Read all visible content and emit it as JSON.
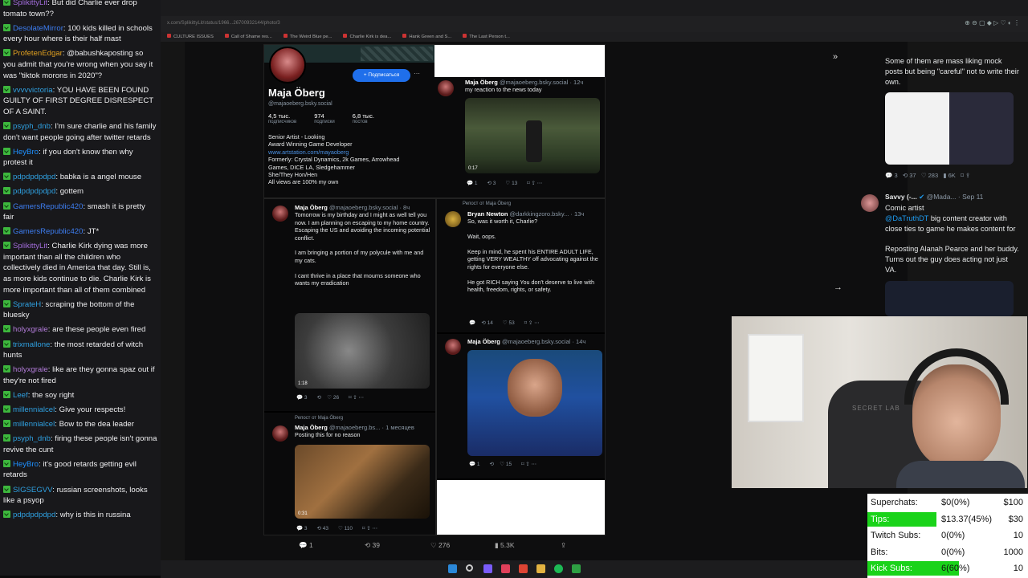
{
  "chat": [
    {
      "user": "SplikittyLit",
      "text": "But did Charlie ever drop tomato town??"
    },
    {
      "user": "DesolateMirror",
      "text": "100 kids killed in schools every hour where is their half mast"
    },
    {
      "user": "ProfetenEdgar",
      "text": "@babushkaposting so you admit that you're wrong when you say it was \"tiktok morons in 2020\"?"
    },
    {
      "user": "vvvvvictoria",
      "text": "YOU HAVE BEEN FOUND GUILTY OF FIRST DEGREE DISRESPECT OF A SAINT."
    },
    {
      "user": "psyph_dnb",
      "text": "I'm sure charlie and his family don't want people going after twitter retards"
    },
    {
      "user": "HeyBro",
      "text": "if you don't know then why protest it"
    },
    {
      "user": "pdpdpdpdpd",
      "text": "babka is a angel mouse"
    },
    {
      "user": "pdpdpdpdpd",
      "text": "gottem"
    },
    {
      "user": "GamersRepublic420",
      "text": "smash it is pretty fair"
    },
    {
      "user": "GamersRepublic420",
      "text": "JT*"
    },
    {
      "user": "SplikittyLit",
      "text": "Charlie Kirk dying was more important than all the children who collectively died in America that day. Still is, as more kids continue to die. Charlie Kirk is more important than all of them combined"
    },
    {
      "user": "SprateH",
      "text": "scraping the bottom of the bluesky"
    },
    {
      "user": "holyxgrale",
      "text": "are these people even fired"
    },
    {
      "user": "trixmallone",
      "text": "the most retarded of witch hunts"
    },
    {
      "user": "holyxgrale",
      "text": "like are they gonna spaz out if they're not fired"
    },
    {
      "user": "Leef",
      "text": "the soy right"
    },
    {
      "user": "millennialcel",
      "text": "Give your respects!"
    },
    {
      "user": "millennialcel",
      "text": "Bow to the dea leader"
    },
    {
      "user": "psyph_dnb",
      "text": "firing these people isn't gonna revive the cunt"
    },
    {
      "user": "HeyBro",
      "text": "it's good retards getting evil retards"
    },
    {
      "user": "SIGSEGVV",
      "text": "russian screenshots, looks like a psyop"
    },
    {
      "user": "pdpdpdpdpd",
      "text": "why is this in russina"
    }
  ],
  "chat_colors": [
    "#a06bd8",
    "#3d7df0",
    "#e0a020",
    "#2fa0e0",
    "#2fa0e0",
    "#1e90ff",
    "#2fa0e0",
    "#2fa0e0",
    "#3d7df0",
    "#3d7df0",
    "#a06bd8",
    "#2fa0e0",
    "#b27cd9",
    "#2fa0e0",
    "#b27cd9",
    "#2fa0e0",
    "#2fa0e0",
    "#2fa0e0",
    "#2fa0e0",
    "#1e90ff",
    "#2fa0e0",
    "#2fa0e0"
  ],
  "browser": {
    "url": "x.com/SplikittyLit/status/1966...26700932144/photo/3",
    "bookmarks": [
      "CULTURE ISSUES",
      "Call of Shame res...",
      "The Weird Blue pe...",
      "Charlie Kirk is dea...",
      "Hank Green and S...",
      "The Last Person t..."
    ]
  },
  "profile": {
    "name": "Maja Öberg",
    "handle": "@majaoeberg.bsky.social",
    "follow": "+ Подписаться",
    "stats": [
      {
        "num": "4,5 тыс.",
        "label": "подписчиков"
      },
      {
        "num": "974",
        "label": "подписки"
      },
      {
        "num": "6,8 тыс.",
        "label": "постов"
      }
    ],
    "bio_1": "Senior Artist - Looking\nAward Winning Game Developer",
    "bio_link": "www.artstation.com/mayaoberg",
    "bio_2": "Formerly: Crystal Dynamics, 2k Games, Arrowhead\nGames, DICE LA, Sledgehammer\nShe/They Hon/Hen\nAll views are 100% my own"
  },
  "posts": {
    "p1": {
      "name": "Maja Öberg",
      "handle": "@majaoeberg.bsky.social · 12ч",
      "text": "my reaction to the news today",
      "dur": "0:17",
      "reply": "1",
      "repost": "3",
      "like": "13"
    },
    "p2": {
      "name": "Maja Öberg",
      "handle": "@majaoeberg.bsky.social · 8ч",
      "text": "Tomorrow is my birthday and I might as well tell you now. I am planning on escaping to my home country. Escaping the US and avoiding the incoming potential conflict.\n\nI am bringing a portion of my polycule with me and my cats.\n\nI cant thrive in a place that mourns someone who wants my eradication",
      "dur": "1:18",
      "reply": "3",
      "like": "26"
    },
    "p3": {
      "repost": "Репост от Maja Öberg",
      "name": "Bryan Newton",
      "handle": "@darkkingzoro.bsky... · 13ч",
      "text": "So, was it worth it, Charlie?\n\nWait, oops.\n\nKeep in mind, he spent his ENTIRE ADULT LIFE, getting VERY WEALTHY off advocating against the rights for everyone else.\n\nHe got RICH saying You don't deserve to live with health, freedom, rights, or safety.",
      "repost_n": "14",
      "like": "53"
    },
    "p4": {
      "name": "Maja Öberg",
      "handle": "@majaoeberg.bsky.social · 14ч",
      "reply": "1",
      "like": "15"
    },
    "p5": {
      "repost": "Репост от Maja Öberg",
      "name": "Maja Öberg",
      "handle": "@majaoeberg.bs... · 1 месяцев",
      "text": "Posting this for no reason",
      "dur": "0:31",
      "reply": "3",
      "repost_n": "43",
      "like": "110"
    }
  },
  "tweet_actions": {
    "reply": "1",
    "repost": "39",
    "like": "276",
    "views": "5.3K"
  },
  "right": {
    "t1_text": "Some of them are mass liking mock posts but being \"careful\" not to write their own.",
    "t1_stats": [
      "3",
      "37",
      "283",
      "6K"
    ],
    "t2_name": "Savvy (-...",
    "t2_handle": "@Mada... · Sep 11",
    "t2_text": "Comic artist",
    "t2_mention": "@DaTruthDT",
    "t2_text2": " big content creator with close ties to game he makes content for",
    "t2_text3": "Reposting Alanah Pearce and her buddy. Turns out the guy does acting not just VA."
  },
  "donations": [
    {
      "label": "Superchats:",
      "value": "$0(0%)",
      "goal": "$100",
      "pct": 0
    },
    {
      "label": "Tips:",
      "value": "$13.37(45%)",
      "goal": "$30",
      "pct": 45
    },
    {
      "label": "Twitch Subs:",
      "value": "0(0%)",
      "goal": "10",
      "pct": 0
    },
    {
      "label": "Bits:",
      "value": "0(0%)",
      "goal": "1000",
      "pct": 0
    },
    {
      "label": "Kick Subs:",
      "value": "6(60%)",
      "goal": "10",
      "pct": 60
    }
  ],
  "colors": {
    "accent": "#1f6feb",
    "progress": "#1ad31a",
    "chat_bg": "#18181b"
  }
}
